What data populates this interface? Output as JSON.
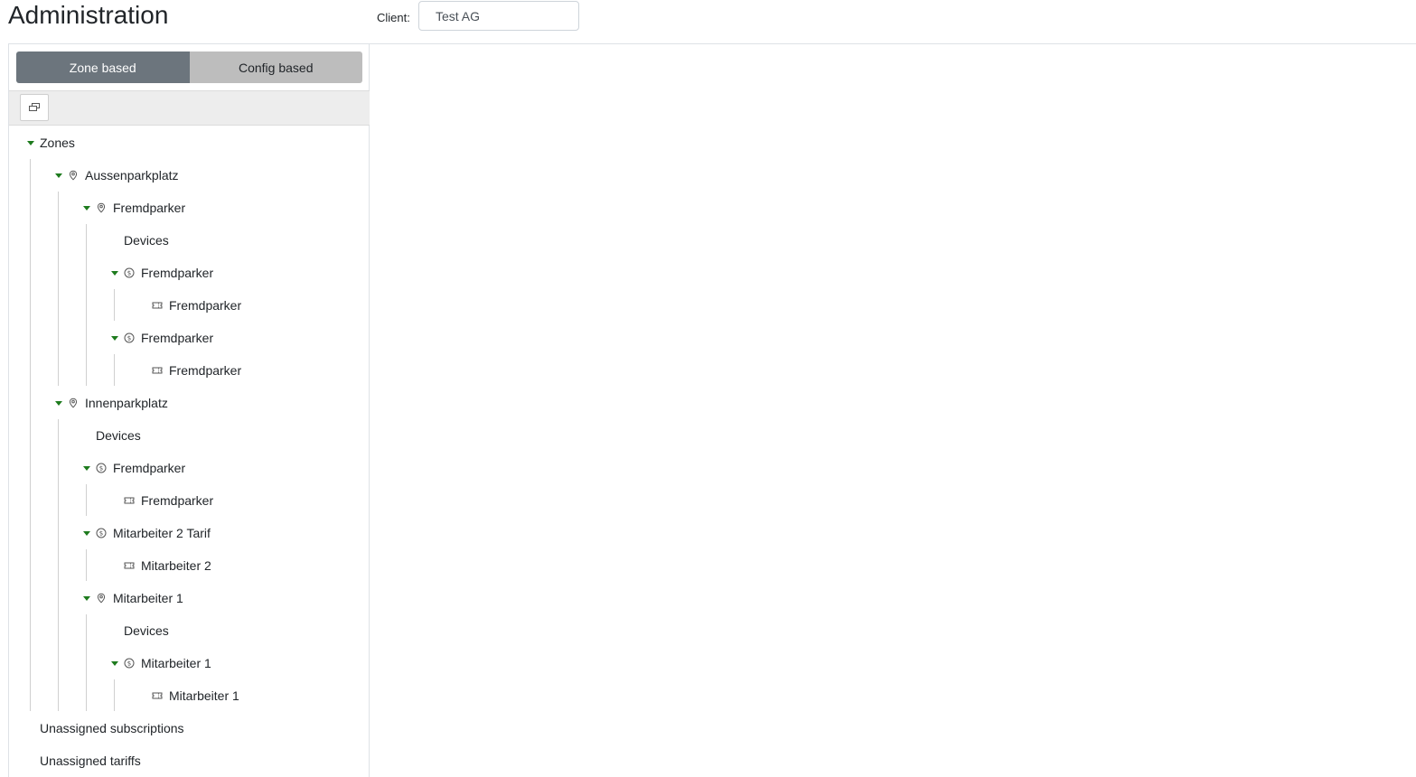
{
  "header": {
    "title": "Administration",
    "client_label": "Client:",
    "client_value": "Test AG"
  },
  "view_toggle": {
    "zone_based": "Zone based",
    "config_based": "Config based",
    "active": "zone_based"
  },
  "tree": {
    "zones": "Zones",
    "aussenparkplatz": "Aussenparkplatz",
    "a_fremdparker_zone": "Fremdparker",
    "a_f_devices": "Devices",
    "a_f_tariff1": "Fremdparker",
    "a_f_sub1": "Fremdparker",
    "a_f_tariff2": "Fremdparker",
    "a_f_sub2": "Fremdparker",
    "innenparkplatz": "Innenparkplatz",
    "i_devices": "Devices",
    "i_tariff_fremdparker": "Fremdparker",
    "i_sub_fremdparker": "Fremdparker",
    "i_tariff_mitarbeiter2": "Mitarbeiter 2 Tarif",
    "i_sub_mitarbeiter2": "Mitarbeiter 2",
    "i_zone_mitarbeiter1": "Mitarbeiter 1",
    "i_m1_devices": "Devices",
    "i_m1_tariff": "Mitarbeiter 1",
    "i_m1_sub": "Mitarbeiter 1",
    "unassigned_subscriptions": "Unassigned subscriptions",
    "unassigned_tariffs": "Unassigned tariffs"
  },
  "colors": {
    "caret": "#1e7b1e",
    "toggle_active": "#6c757d",
    "toggle_inactive": "#bdbdbd"
  }
}
